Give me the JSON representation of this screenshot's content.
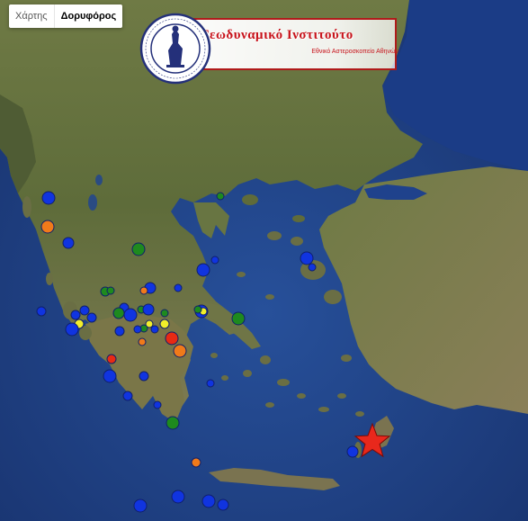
{
  "map_type_control": {
    "options": [
      "Χάρτης",
      "Δορυφόρος"
    ],
    "selected": "Δορυφόρος"
  },
  "banner": {
    "title": "Γεωδυναμικό Ινστιτούτο",
    "subtitle": "Εθνικό Αστεροσκοπείο Αθηνών",
    "seal_text": "Εθνικό Αστεροσκοπείο Αθηνών · National Observatory of Athens"
  },
  "colors": {
    "blue": "#1034e0",
    "green": "#1e8a1e",
    "orange": "#f07a1a",
    "red": "#e82a14",
    "yellow": "#f2ee2a",
    "star": "#e8281c",
    "banner_red": "#c8141c"
  },
  "main_event": {
    "icon": "red-star-icon"
  }
}
